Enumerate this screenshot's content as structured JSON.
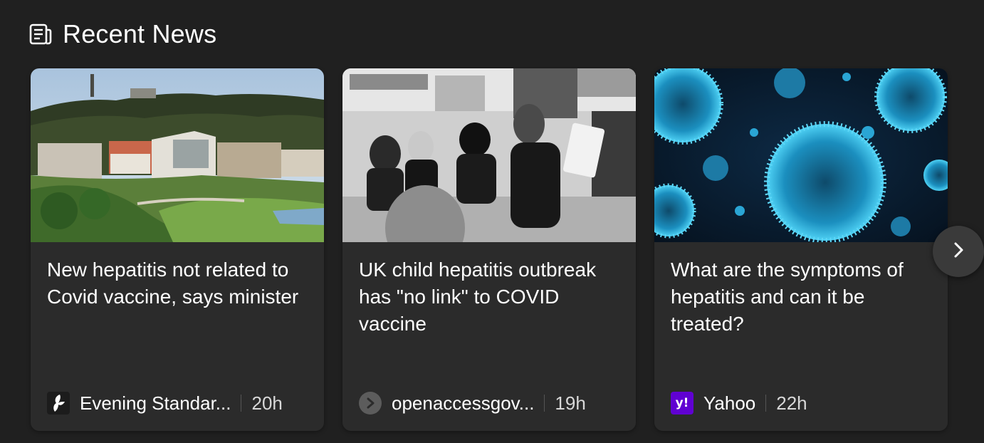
{
  "section": {
    "title": "Recent News",
    "icon": "newspaper-icon"
  },
  "cards": [
    {
      "headline": "New hepatitis not related to Covid vaccine, says minister",
      "source": "Evening Standar...",
      "time": "20h",
      "source_icon": "evening-standard-logo-icon",
      "image": "scottish-parliament-photo"
    },
    {
      "headline": "UK child hepatitis outbreak has \"no link\" to COVID vaccine",
      "source": "openaccessgov...",
      "time": "19h",
      "source_icon": "openaccessgov-logo-icon",
      "image": "classroom-photo"
    },
    {
      "headline": "What are the symptoms of hepatitis and can it be treated?",
      "source": "Yahoo",
      "time": "22h",
      "source_icon": "yahoo-logo-icon",
      "logo_text": "y!",
      "image": "virus-illustration"
    }
  ],
  "navigation": {
    "next_icon": "chevron-right-icon"
  },
  "colors": {
    "background": "#202020",
    "card": "#2b2b2b",
    "yahoo_brand": "#6001d2",
    "virus_blue": "#27a9d6"
  }
}
